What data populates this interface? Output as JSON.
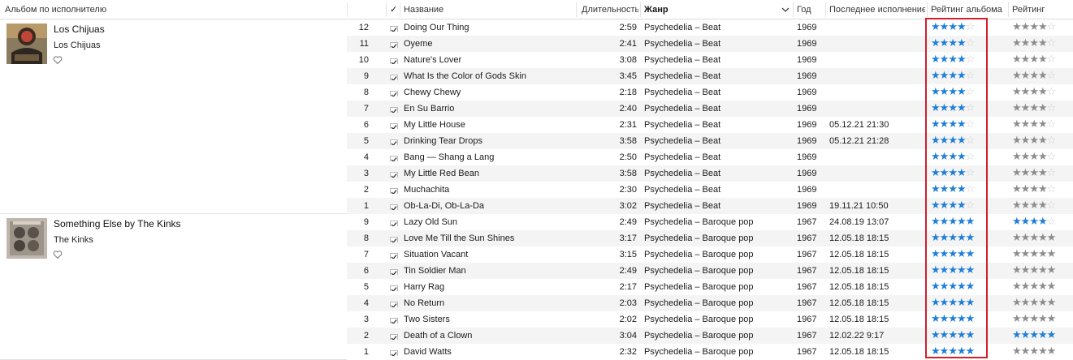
{
  "columns": {
    "album_by_artist": "Альбом по исполнителю",
    "check": "✓",
    "name": "Название",
    "duration": "Длительность",
    "genre": "Жанр",
    "year": "Год",
    "last_played": "Последнее исполнение",
    "album_rating": "Рейтинг альбома",
    "rating": "Рейтинг"
  },
  "colors": {
    "star_on": "#1f7fd8",
    "star_gray": "#8d8d8d",
    "highlight": "#d0202a"
  },
  "albums": [
    {
      "title": "Los Chijuas",
      "artist": "Los Chijuas",
      "rows": [
        {
          "num": "12",
          "name": "Doing Our Thing",
          "duration": "2:59",
          "genre": "Psychedelia – Beat",
          "year": "1969",
          "played": "",
          "album_rating": 4,
          "rating": 4,
          "rating_blue": false
        },
        {
          "num": "11",
          "name": "Oyeme",
          "duration": "2:41",
          "genre": "Psychedelia – Beat",
          "year": "1969",
          "played": "",
          "album_rating": 4,
          "rating": 4,
          "rating_blue": false
        },
        {
          "num": "10",
          "name": "Nature's Lover",
          "duration": "3:08",
          "genre": "Psychedelia – Beat",
          "year": "1969",
          "played": "",
          "album_rating": 4,
          "rating": 4,
          "rating_blue": false
        },
        {
          "num": "9",
          "name": "What Is the Color of Gods Skin",
          "duration": "3:45",
          "genre": "Psychedelia – Beat",
          "year": "1969",
          "played": "",
          "album_rating": 4,
          "rating": 4,
          "rating_blue": false
        },
        {
          "num": "8",
          "name": "Chewy Chewy",
          "duration": "2:18",
          "genre": "Psychedelia – Beat",
          "year": "1969",
          "played": "",
          "album_rating": 4,
          "rating": 4,
          "rating_blue": false
        },
        {
          "num": "7",
          "name": "En Su Barrio",
          "duration": "2:40",
          "genre": "Psychedelia – Beat",
          "year": "1969",
          "played": "",
          "album_rating": 4,
          "rating": 4,
          "rating_blue": false
        },
        {
          "num": "6",
          "name": "My Little House",
          "duration": "2:31",
          "genre": "Psychedelia – Beat",
          "year": "1969",
          "played": "05.12.21 21:30",
          "album_rating": 4,
          "rating": 4,
          "rating_blue": false
        },
        {
          "num": "5",
          "name": "Drinking Tear Drops",
          "duration": "3:58",
          "genre": "Psychedelia – Beat",
          "year": "1969",
          "played": "05.12.21 21:28",
          "album_rating": 4,
          "rating": 4,
          "rating_blue": false
        },
        {
          "num": "4",
          "name": "Bang — Shang a Lang",
          "duration": "2:50",
          "genre": "Psychedelia – Beat",
          "year": "1969",
          "played": "",
          "album_rating": 4,
          "rating": 4,
          "rating_blue": false
        },
        {
          "num": "3",
          "name": "My Little Red Bean",
          "duration": "3:58",
          "genre": "Psychedelia – Beat",
          "year": "1969",
          "played": "",
          "album_rating": 4,
          "rating": 4,
          "rating_blue": false
        },
        {
          "num": "2",
          "name": "Muchachita",
          "duration": "2:30",
          "genre": "Psychedelia – Beat",
          "year": "1969",
          "played": "",
          "album_rating": 4,
          "rating": 4,
          "rating_blue": false
        },
        {
          "num": "1",
          "name": "Ob-La-Di, Ob-La-Da",
          "duration": "3:02",
          "genre": "Psychedelia – Beat",
          "year": "1969",
          "played": "19.11.21 10:50",
          "album_rating": 4,
          "rating": 4,
          "rating_blue": false
        }
      ]
    },
    {
      "title": "Something Else by The Kinks",
      "artist": "The Kinks",
      "rows": [
        {
          "num": "9",
          "name": "Lazy Old Sun",
          "duration": "2:49",
          "genre": "Psychedelia – Baroque pop",
          "year": "1967",
          "played": "24.08.19 13:07",
          "album_rating": 5,
          "rating": 4,
          "rating_blue": true
        },
        {
          "num": "8",
          "name": "Love Me Till the Sun Shines",
          "duration": "3:17",
          "genre": "Psychedelia – Baroque pop",
          "year": "1967",
          "played": "12.05.18 18:15",
          "album_rating": 5,
          "rating": 5,
          "rating_blue": false
        },
        {
          "num": "7",
          "name": "Situation Vacant",
          "duration": "3:15",
          "genre": "Psychedelia – Baroque pop",
          "year": "1967",
          "played": "12.05.18 18:15",
          "album_rating": 5,
          "rating": 5,
          "rating_blue": false
        },
        {
          "num": "6",
          "name": "Tin Soldier Man",
          "duration": "2:49",
          "genre": "Psychedelia – Baroque pop",
          "year": "1967",
          "played": "12.05.18 18:15",
          "album_rating": 5,
          "rating": 5,
          "rating_blue": false
        },
        {
          "num": "5",
          "name": "Harry Rag",
          "duration": "2:17",
          "genre": "Psychedelia – Baroque pop",
          "year": "1967",
          "played": "12.05.18 18:15",
          "album_rating": 5,
          "rating": 5,
          "rating_blue": false
        },
        {
          "num": "4",
          "name": "No Return",
          "duration": "2:03",
          "genre": "Psychedelia – Baroque pop",
          "year": "1967",
          "played": "12.05.18 18:15",
          "album_rating": 5,
          "rating": 5,
          "rating_blue": false
        },
        {
          "num": "3",
          "name": "Two Sisters",
          "duration": "2:02",
          "genre": "Psychedelia – Baroque pop",
          "year": "1967",
          "played": "12.05.18 18:15",
          "album_rating": 5,
          "rating": 5,
          "rating_blue": false
        },
        {
          "num": "2",
          "name": "Death of a Clown",
          "duration": "3:04",
          "genre": "Psychedelia – Baroque pop",
          "year": "1967",
          "played": "12.02.22 9:17",
          "album_rating": 5,
          "rating": 5,
          "rating_blue": true
        },
        {
          "num": "1",
          "name": "David Watts",
          "duration": "2:32",
          "genre": "Psychedelia – Baroque pop",
          "year": "1967",
          "played": "12.05.18 18:15",
          "album_rating": 5,
          "rating": 5,
          "rating_blue": false
        }
      ]
    }
  ]
}
